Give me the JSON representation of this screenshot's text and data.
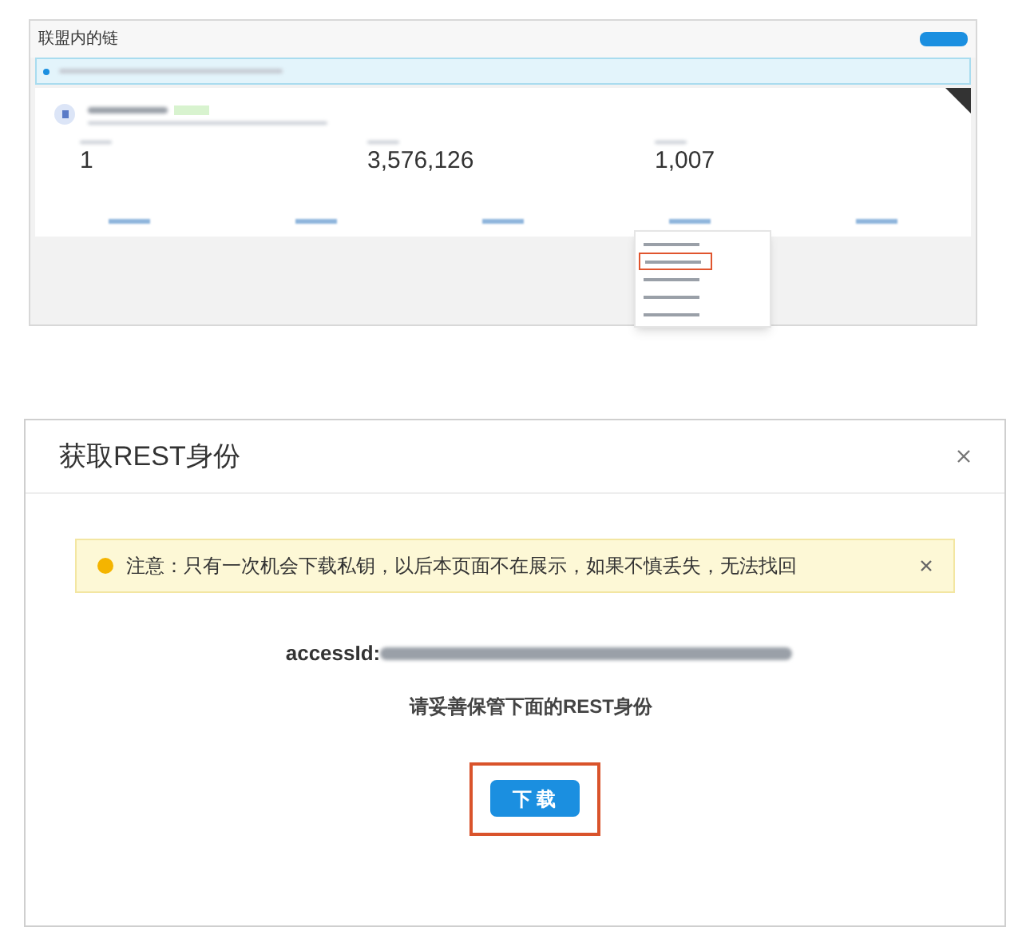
{
  "top_panel": {
    "title": "联盟内的链",
    "stats": [
      {
        "value": "1"
      },
      {
        "value": "3,576,126"
      },
      {
        "value": "1,007"
      }
    ],
    "menu": [
      {
        "selected": false
      },
      {
        "selected": true
      },
      {
        "selected": false
      },
      {
        "selected": false
      },
      {
        "selected": false
      }
    ]
  },
  "dialog": {
    "title": "获取REST身份",
    "alert": "注意：只有一次机会下载私钥，以后本页面不在展示，如果不慎丢失，无法找回",
    "access_label": "accessId:",
    "note": "请妥善保管下面的REST身份",
    "button": "下 载"
  }
}
